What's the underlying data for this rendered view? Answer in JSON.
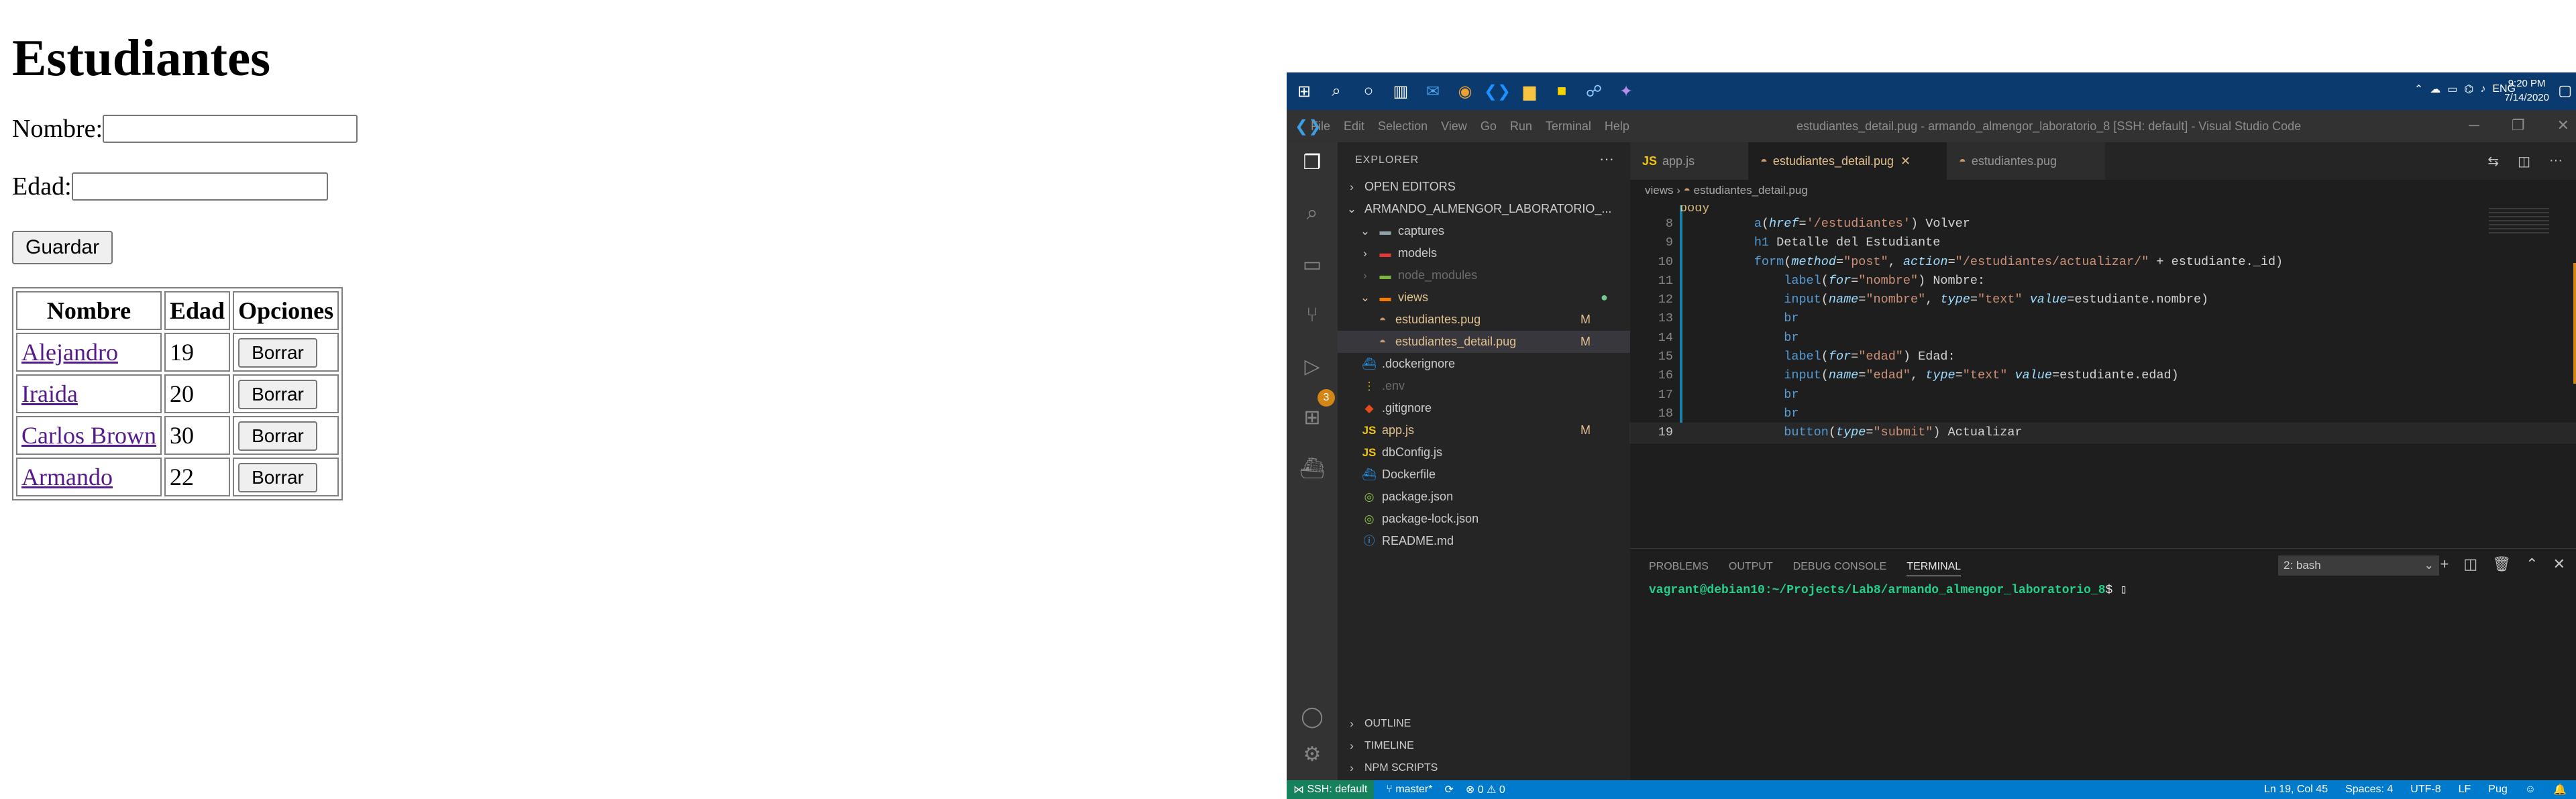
{
  "webpage": {
    "title": "Estudiantes",
    "form": {
      "nombre_label": "Nombre:",
      "nombre_value": "",
      "edad_label": "Edad:",
      "edad_value": "",
      "save_label": "Guardar"
    },
    "table": {
      "headers": [
        "Nombre",
        "Edad",
        "Opciones"
      ],
      "rows": [
        {
          "nombre": "Alejandro",
          "edad": "19",
          "action": "Borrar"
        },
        {
          "nombre": "Iraida",
          "edad": "20",
          "action": "Borrar"
        },
        {
          "nombre": "Carlos Brown",
          "edad": "30",
          "action": "Borrar"
        },
        {
          "nombre": "Armando",
          "edad": "22",
          "action": "Borrar"
        }
      ]
    }
  },
  "taskbar": {
    "tray_lang": "ENG",
    "time": "9:20 PM",
    "date": "7/14/2020"
  },
  "vscode": {
    "menu": [
      "File",
      "Edit",
      "Selection",
      "View",
      "Go",
      "Run",
      "Terminal",
      "Help"
    ],
    "window_title": "estudiantes_detail.pug - armando_almengor_laboratorio_8 [SSH: default] - Visual Studio Code",
    "explorer": {
      "header": "EXPLORER",
      "open_editors": "OPEN EDITORS",
      "project": "ARMANDO_ALMENGOR_LABORATORIO_...",
      "items": [
        {
          "name": "captures",
          "status": ""
        },
        {
          "name": "models",
          "status": ""
        },
        {
          "name": "node_modules",
          "status": ""
        },
        {
          "name": "views",
          "status": "●"
        },
        {
          "name": "estudiantes.pug",
          "status": "M"
        },
        {
          "name": "estudiantes_detail.pug",
          "status": "M"
        },
        {
          "name": ".dockerignore",
          "status": ""
        },
        {
          "name": ".env",
          "status": ""
        },
        {
          "name": ".gitignore",
          "status": ""
        },
        {
          "name": "app.js",
          "status": "M"
        },
        {
          "name": "dbConfig.js",
          "status": ""
        },
        {
          "name": "Dockerfile",
          "status": ""
        },
        {
          "name": "package.json",
          "status": ""
        },
        {
          "name": "package-lock.json",
          "status": ""
        },
        {
          "name": "README.md",
          "status": ""
        }
      ],
      "outline": "OUTLINE",
      "timeline": "TIMELINE",
      "npm_scripts": "NPM SCRIPTS"
    },
    "tabs": [
      "app.js",
      "estudiantes_detail.pug",
      "estudiantes.pug"
    ],
    "breadcrumb": [
      "views",
      "estudiantes_detail.pug"
    ],
    "code_lines": [
      {
        "n": "",
        "text": "body"
      },
      {
        "n": "8",
        "text": "a(href='/estudiantes') Volver"
      },
      {
        "n": "9",
        "text": "h1 Detalle del Estudiante"
      },
      {
        "n": "10",
        "text": "form(method=\"post\", action=\"/estudiantes/actualizar/\" + estudiante._id)"
      },
      {
        "n": "11",
        "text": "label(for=\"nombre\") Nombre:"
      },
      {
        "n": "12",
        "text": "input(name=\"nombre\", type=\"text\" value=estudiante.nombre)"
      },
      {
        "n": "13",
        "text": "br"
      },
      {
        "n": "14",
        "text": "br"
      },
      {
        "n": "15",
        "text": "label(for=\"edad\") Edad:"
      },
      {
        "n": "16",
        "text": "input(name=\"edad\", type=\"text\" value=estudiante.edad)"
      },
      {
        "n": "17",
        "text": "br"
      },
      {
        "n": "18",
        "text": "br"
      },
      {
        "n": "19",
        "text": "button(type=\"submit\") Actualizar"
      }
    ],
    "panel": {
      "tabs": [
        "PROBLEMS",
        "OUTPUT",
        "DEBUG CONSOLE",
        "TERMINAL"
      ],
      "active_tab": "TERMINAL",
      "terminal_select": "2: bash",
      "prompt_user": "vagrant@debian10:~/Projects/Lab8/armando_almengor_laboratorio_8",
      "prompt_symbol": "$ "
    },
    "statusbar": {
      "remote": "SSH: default",
      "branch": "master*",
      "problems": "⊗ 0 ⚠ 0",
      "position": "Ln 19, Col 45",
      "spaces": "Spaces: 4",
      "encoding": "UTF-8",
      "eol": "LF",
      "language": "Pug"
    },
    "colors": {
      "accent": "#007acc",
      "modified": "#e2c08d",
      "untracked": "#73c991",
      "remote": "#16825d"
    }
  }
}
